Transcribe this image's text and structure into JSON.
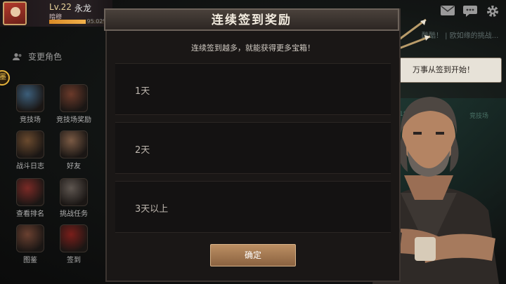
{
  "player": {
    "level": "Lv.22",
    "name": "永龙",
    "subtitle": "暗穆",
    "xp_text": "95.02%",
    "xp_fraction": 0.6
  },
  "top_icons": [
    "mail-icon",
    "chat-icon",
    "settings-icon"
  ],
  "sidebar": {
    "change_role_label": "变更角色",
    "badge_text": "墨",
    "items": [
      {
        "label": "竞技场",
        "icon": "arena-icon",
        "color": "#3c5e7a"
      },
      {
        "label": "竞技场奖励",
        "icon": "arena-reward-icon",
        "color": "#6b3a2a"
      },
      {
        "label": "战斗日志",
        "icon": "battle-log-icon",
        "color": "#6a4a2e"
      },
      {
        "label": "好友",
        "icon": "friends-icon",
        "color": "#7a5a44"
      },
      {
        "label": "查看排名",
        "icon": "ranking-icon",
        "color": "#7a2a26"
      },
      {
        "label": "挑战任务",
        "icon": "challenge-task-icon",
        "color": "#5e5650"
      },
      {
        "label": "图鉴",
        "icon": "handbook-icon",
        "color": "#6a4030"
      },
      {
        "label": "签到",
        "icon": "checkin-icon",
        "color": "#7a1e1a"
      }
    ]
  },
  "modal": {
    "title": "连续签到奖励",
    "subtitle": "连续签到越多，就能获得更多宝箱！",
    "rows": [
      {
        "label": "1天"
      },
      {
        "label": "2天"
      },
      {
        "label": "3天以上"
      }
    ],
    "confirm_label": "确定"
  },
  "npc": {
    "speech": "万事从签到开始！"
  },
  "background": {
    "news_text": "酷酷！ | 欧如缘的挑战..."
  }
}
